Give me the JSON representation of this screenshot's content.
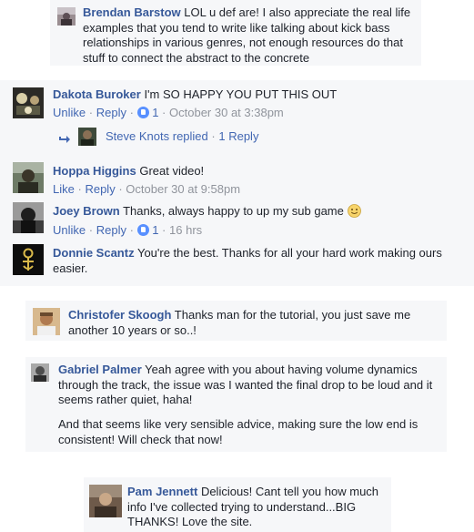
{
  "comments": [
    {
      "name": "Brendan Barstow",
      "text": "LOL u def are! I also appreciate the real life examples that you tend to write like talking about kick bass relationships in various genres, not enough resources do that stuff to connect the abstract to the concrete"
    },
    {
      "name": "Dakota Buroker",
      "text": "I'm SO HAPPY YOU PUT THIS OUT",
      "actions": {
        "like": "Unlike",
        "reply": "Reply",
        "likes": "1",
        "time": "October 30 at 3:38pm"
      },
      "replies": {
        "author": "Steve Knots",
        "verb": "replied",
        "count": "1 Reply"
      }
    },
    {
      "name": "Hoppa Higgins",
      "text": "Great video!",
      "actions": {
        "like": "Like",
        "reply": "Reply",
        "time": "October 30 at 9:58pm"
      }
    },
    {
      "name": "Joey Brown",
      "text": "Thanks, always happy to up my sub game",
      "emoji": "smile",
      "actions": {
        "like": "Unlike",
        "reply": "Reply",
        "likes": "1",
        "time": "16 hrs"
      }
    },
    {
      "name": "Donnie Scantz",
      "text": "You're the best. Thanks for all your hard work making ours easier."
    },
    {
      "name": "Christofer Skoogh",
      "text": "Thanks man for the tutorial, you just save me another 10 years or so..!"
    },
    {
      "name": "Gabriel Palmer",
      "text": "Yeah agree with you about having volume dynamics through the track, the issue was I wanted the final drop to be loud and it seems rather quiet, haha!",
      "text2": "And that seems like very sensible advice, making sure the low end is consistent! Will check that now!"
    },
    {
      "name": "Pam Jennett",
      "text": "Delicious! Cant tell you how much info I've collected trying to understand...BIG THANKS! Love the site."
    }
  ],
  "colors": {
    "link": "#365899",
    "action": "#4267b2",
    "meta": "#90949c",
    "card": "#f6f7f9",
    "like_badge": "#5890ff"
  }
}
